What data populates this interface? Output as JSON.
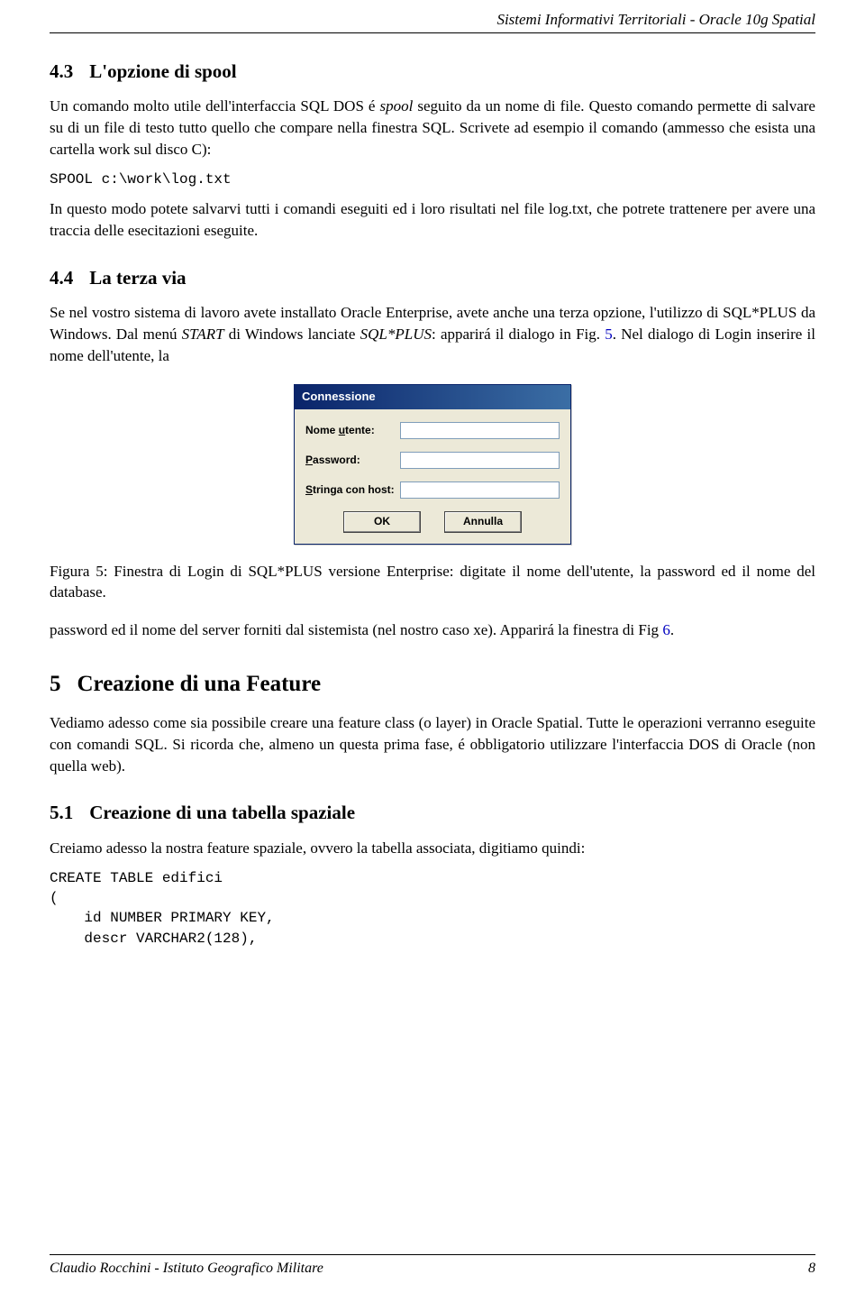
{
  "header": "Sistemi Informativi Territoriali - Oracle 10g Spatial",
  "sec43": {
    "num": "4.3",
    "title": "L'opzione di spool"
  },
  "p43a": "Un comando molto utile dell'interfaccia SQL DOS é ",
  "p43a_it": "spool",
  "p43a2": " seguito da un nome di file. Questo comando permette di salvare su di un file di testo tutto quello che compare nella finestra SQL. Scrivete ad esempio il comando (ammesso che esista una cartella work sul disco C):",
  "code43": "SPOOL c:\\work\\log.txt",
  "p43b": "In questo modo potete salvarvi tutti i comandi eseguiti ed i loro risultati nel file log.txt, che potrete trattenere per avere una traccia delle esecitazioni eseguite.",
  "sec44": {
    "num": "4.4",
    "title": "La terza via"
  },
  "p44a": "Se nel vostro sistema di lavoro avete installato Oracle Enterprise, avete anche una terza opzione, l'utilizzo di SQL*PLUS da Windows.  Dal menú ",
  "p44a_it1": "START",
  "p44a2": " di Windows lanciate ",
  "p44a_it2": "SQL*PLUS",
  "p44a3": ": apparirá il dialogo in Fig. ",
  "p44a_link": "5",
  "p44a4": ". Nel dialogo di Login inserire il nome dell'utente, la",
  "dialog": {
    "title": "Connessione",
    "row1_pre": "Nome ",
    "row1_ul": "u",
    "row1_post": "tente:",
    "row2_ul": "P",
    "row2_post": "assword:",
    "row3_ul": "S",
    "row3_post": "tringa con host:",
    "ok": "OK",
    "cancel": "Annulla"
  },
  "figcaption": "Figura 5: Finestra di Login di SQL*PLUS versione Enterprise: digitate il nome dell'utente, la password ed il nome del database.",
  "p44b": "password ed il nome del server forniti dal sistemista (nel nostro caso xe). Apparirá la finestra di Fig ",
  "p44b_link": "6",
  "p44b2": ".",
  "sec5": {
    "num": "5",
    "title": "Creazione di una Feature"
  },
  "p5a": "Vediamo adesso come sia possibile creare una feature class (o layer) in Oracle Spatial. Tutte le operazioni verranno eseguite con comandi SQL. Si ricorda che, almeno un questa prima fase, é obbligatorio utilizzare l'interfaccia DOS di Oracle (non quella web).",
  "sec51": {
    "num": "5.1",
    "title": "Creazione di una tabella spaziale"
  },
  "p51a": "Creiamo adesso la nostra feature spaziale, ovvero la tabella associata, digitiamo quindi:",
  "code51": "CREATE TABLE edifici\n(\n    id NUMBER PRIMARY KEY,\n    descr VARCHAR2(128),",
  "footer_left": "Claudio Rocchini - Istituto Geografico Militare",
  "footer_right": "8"
}
